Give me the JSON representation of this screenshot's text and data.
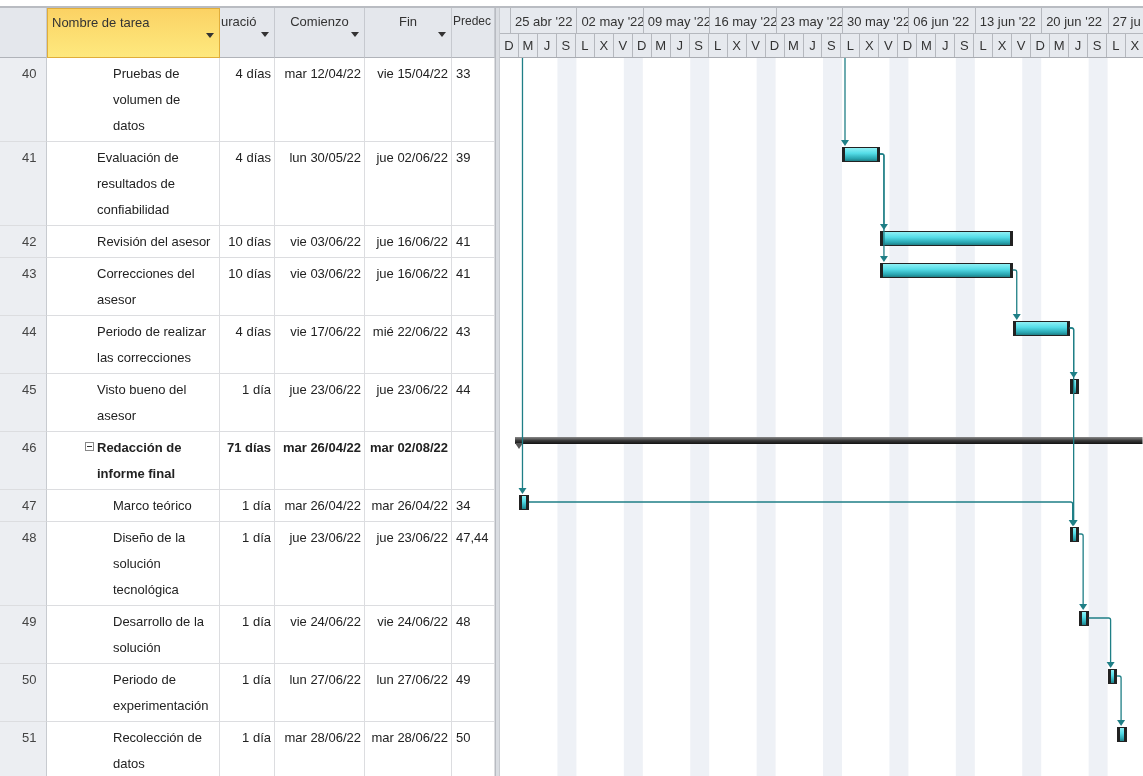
{
  "columns": [
    {
      "label": "Nombre de tarea",
      "selected": true,
      "dropdown": true
    },
    {
      "label": "uració",
      "selected": false,
      "dropdown": true
    },
    {
      "label": "Comienzo",
      "selected": false,
      "dropdown": true
    },
    {
      "label": "Fin",
      "selected": false,
      "dropdown": true
    },
    {
      "label": "Predec",
      "selected": false,
      "dropdown": false
    }
  ],
  "timescale": {
    "weeks": [
      "25 abr '22",
      "02 may '22",
      "09 may '22",
      "16 may '22",
      "23 may '22",
      "30 may '22",
      "06 jun '22",
      "13 jun '22",
      "20 jun '22",
      "27 ju"
    ],
    "days": [
      "D",
      "M",
      "J",
      "S",
      "L",
      "X",
      "V",
      "D",
      "M",
      "J",
      "S",
      "L",
      "X",
      "V",
      "D",
      "M",
      "J",
      "S",
      "L",
      "X",
      "V",
      "D",
      "M",
      "J",
      "S",
      "L",
      "X",
      "V",
      "D",
      "M",
      "J",
      "S",
      "L",
      "X"
    ]
  },
  "rows": [
    {
      "children": [
        {
          "id": "40",
          "kind": "task",
          "name": "Pruebas de volumen de datos",
          "duration": "4 días",
          "start": "mar 12/04/22",
          "finish": "vie 15/04/22",
          "predecessors": "33"
        }
      ]
    },
    {
      "id": "41",
      "kind": "task",
      "name": "Evaluación de resultados de confiabilidad",
      "duration": "4 días",
      "start": "lun 30/05/22",
      "finish": "jue 02/06/22",
      "predecessors": "39"
    },
    {
      "id": "42",
      "kind": "task",
      "name": "Revisión del asesor",
      "duration": "10 días",
      "start": "vie 03/06/22",
      "finish": "jue 16/06/22",
      "predecessors": "41"
    },
    {
      "id": "43",
      "kind": "task",
      "name": "Correcciones del asesor",
      "duration": "10 días",
      "start": "vie 03/06/22",
      "finish": "jue 16/06/22",
      "predecessors": "41"
    },
    {
      "id": "44",
      "kind": "task",
      "name": "Periodo de realizar las correcciones",
      "duration": "4 días",
      "start": "vie 17/06/22",
      "finish": "mié 22/06/22",
      "predecessors": "43"
    },
    {
      "id": "45",
      "kind": "task",
      "name": "Visto bueno del asesor",
      "duration": "1 día",
      "start": "jue 23/06/22",
      "finish": "jue 23/06/22",
      "predecessors": "44"
    },
    {
      "id": "46",
      "kind": "summary",
      "expanded": true,
      "name": "Redacción de informe final",
      "duration": "71 días",
      "start": "mar 26/04/22",
      "finish": "mar 02/08/22",
      "children": [
        {
          "id": "47",
          "kind": "task",
          "name": "Marco teórico",
          "duration": "1 día",
          "start": "mar 26/04/22",
          "finish": "mar 26/04/22",
          "predecessors": "34"
        },
        {
          "id": "48",
          "kind": "task",
          "name": "Diseño de la solución tecnológica",
          "duration": "1 día",
          "start": "jue 23/06/22",
          "finish": "jue 23/06/22",
          "predecessors": "47,44"
        },
        {
          "id": "49",
          "kind": "task",
          "name": "Desarrollo de la solución",
          "duration": "1 día",
          "start": "vie 24/06/22",
          "finish": "vie 24/06/22",
          "predecessors": "48"
        },
        {
          "id": "50",
          "kind": "task",
          "name": "Periodo de experimentación",
          "duration": "1 día",
          "start": "lun 27/06/22",
          "finish": "lun 27/06/22",
          "predecessors": "49"
        },
        {
          "id": "51",
          "kind": "task",
          "name": "Recolección de datos",
          "duration": "1 día",
          "start": "mar 28/06/22",
          "finish": "mar 28/06/22",
          "predecessors": "50"
        }
      ]
    }
  ]
}
